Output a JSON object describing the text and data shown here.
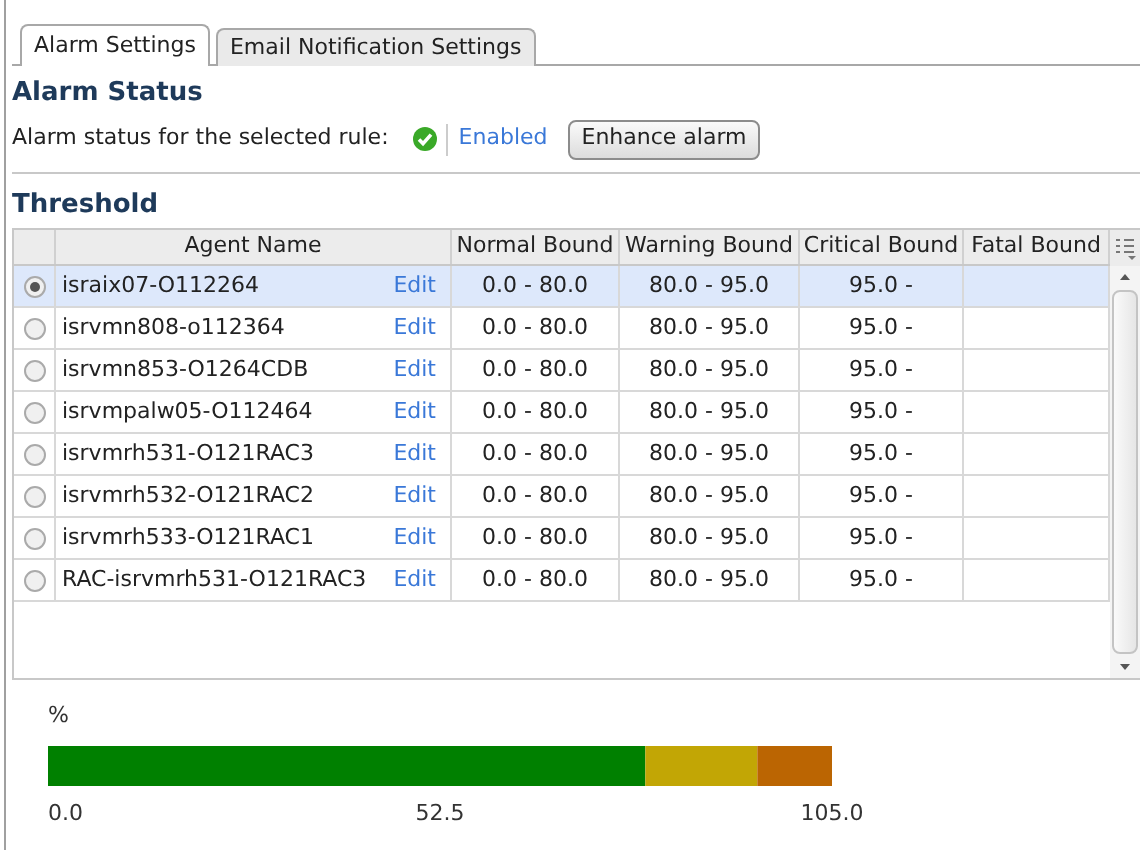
{
  "tabs": [
    {
      "label": "Alarm Settings",
      "selected": true
    },
    {
      "label": "Email Notification Settings",
      "selected": false
    }
  ],
  "alarm_status": {
    "heading": "Alarm Status",
    "label": "Alarm status for the selected rule:",
    "enabled": true,
    "status_link": "Enabled",
    "button": "Enhance alarm"
  },
  "threshold": {
    "heading": "Threshold",
    "table": {
      "columns": [
        "Agent Name",
        "Normal Bound",
        "Warning Bound",
        "Critical Bound",
        "Fatal Bound"
      ],
      "rows": [
        {
          "selected": true,
          "agent": "israix07-O112264",
          "edit": "Edit",
          "normal": "0.0 - 80.0",
          "warning": "80.0 - 95.0",
          "critical": "95.0 -"
        },
        {
          "selected": false,
          "agent": "isrvmn808-o112364",
          "edit": "Edit",
          "normal": "0.0 - 80.0",
          "warning": "80.0 - 95.0",
          "critical": "95.0 -"
        },
        {
          "selected": false,
          "agent": "isrvmn853-O1264CDB",
          "edit": "Edit",
          "normal": "0.0 - 80.0",
          "warning": "80.0 - 95.0",
          "critical": "95.0 -"
        },
        {
          "selected": false,
          "agent": "isrvmpalw05-O112464",
          "edit": "Edit",
          "normal": "0.0 - 80.0",
          "warning": "80.0 - 95.0",
          "critical": "95.0 -"
        },
        {
          "selected": false,
          "agent": "isrvmrh531-O121RAC3",
          "edit": "Edit",
          "normal": "0.0 - 80.0",
          "warning": "80.0 - 95.0",
          "critical": "95.0 -"
        },
        {
          "selected": false,
          "agent": "isrvmrh532-O121RAC2",
          "edit": "Edit",
          "normal": "0.0 - 80.0",
          "warning": "80.0 - 95.0",
          "critical": "95.0 -"
        },
        {
          "selected": false,
          "agent": "isrvmrh533-O121RAC1",
          "edit": "Edit",
          "normal": "0.0 - 80.0",
          "warning": "80.0 - 95.0",
          "critical": "95.0 -"
        },
        {
          "selected": false,
          "agent": "RAC-isrvmrh531-O121RAC3",
          "edit": "Edit",
          "normal": "0.0 - 80.0",
          "warning": "80.0 - 95.0",
          "critical": "95.0 -"
        }
      ]
    },
    "chart_data": {
      "type": "bar",
      "orientation": "horizontal",
      "stacked": true,
      "title": "%",
      "series": [
        {
          "color": "#008000",
          "values": [
            80
          ]
        },
        {
          "color": "#c2a605",
          "values": [
            15
          ]
        },
        {
          "color": "#bb6502",
          "values": [
            10
          ]
        }
      ],
      "xlim": [
        0,
        105
      ],
      "xticks": [
        {
          "value": 0,
          "label": "0.0"
        },
        {
          "value": 52.5,
          "label": "52.5"
        },
        {
          "value": 105,
          "label": "105.0"
        }
      ]
    }
  }
}
